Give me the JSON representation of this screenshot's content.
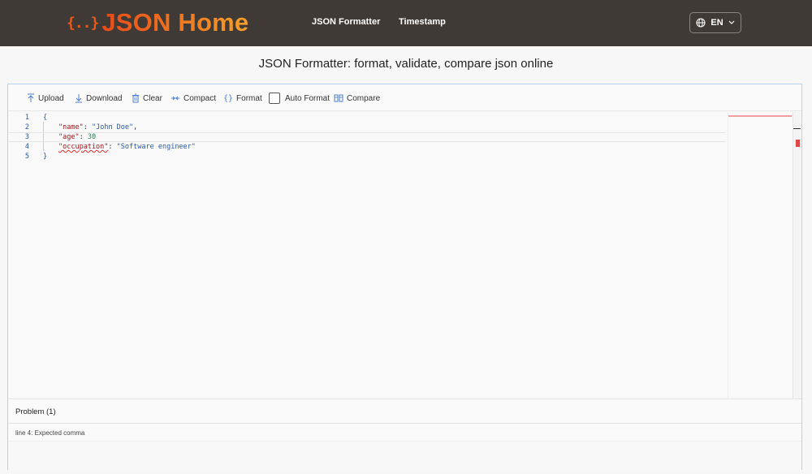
{
  "header": {
    "logo_braces": "{..}",
    "logo_text": "JSON Home",
    "nav": [
      {
        "label": "JSON Formatter"
      },
      {
        "label": "Timestamp"
      }
    ],
    "language": "EN"
  },
  "page_title": "JSON Formatter: format, validate, compare json online",
  "toolbar": {
    "upload": "Upload",
    "download": "Download",
    "clear": "Clear",
    "compact": "Compact",
    "format": "Format",
    "auto_format": "Auto Format",
    "auto_format_checked": false,
    "compare": "Compare"
  },
  "editor": {
    "lines": [
      {
        "no": "1",
        "text": "{"
      },
      {
        "no": "2",
        "key": "\"name\"",
        "sep": ": ",
        "value": "\"John Doe\"",
        "tail": ","
      },
      {
        "no": "3",
        "key": "\"age\"",
        "sep": ": ",
        "value": "30",
        "tail": ""
      },
      {
        "no": "4",
        "key": "\"occupation\"",
        "sep": ": ",
        "value": "\"Software engineer\"",
        "tail": ""
      },
      {
        "no": "5",
        "text": "}"
      }
    ],
    "error_line": "4"
  },
  "problems": {
    "title": "Problem (1)",
    "items": [
      {
        "message": "line 4: Expected comma"
      }
    ]
  },
  "colors": {
    "header_bg": "#3f3a36",
    "logo_accent": "#e8591c",
    "toolbar_icon": "#4a7fd0",
    "json_key": "#a3151a",
    "json_string": "#2a5aa5",
    "json_number": "#228050",
    "error": "#e34848"
  }
}
